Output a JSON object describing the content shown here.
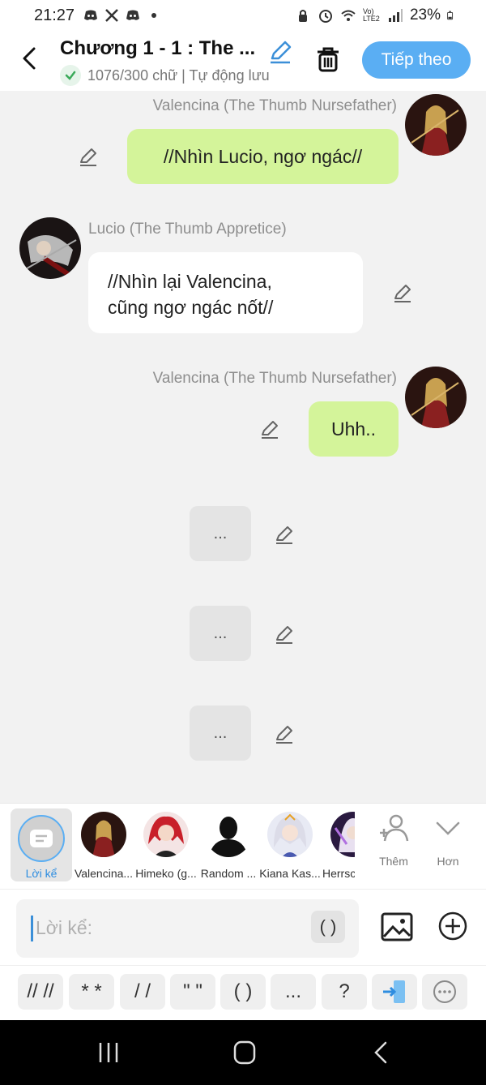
{
  "status": {
    "time": "21:27",
    "battery": "23%",
    "network_label": "Vo) LTE2",
    "left_icons": [
      "discord-icon",
      "x-icon",
      "discord-icon",
      "dot"
    ]
  },
  "header": {
    "title": "Chương 1 - 1 : The ...",
    "word_count": "1076/300 chữ | Tự động lưu",
    "next_label": "Tiếp theo"
  },
  "messages": [
    {
      "speaker": "Valencina (The Thumb Nursefather)",
      "text": "//Nhìn Lucio, ngơ ngác//",
      "side": "right",
      "style": "green"
    },
    {
      "speaker": "Lucio (The Thumb Appretice)",
      "text_line1": "//Nhìn lại Valencina,",
      "text_line2": "cũng ngơ ngác nốt//",
      "side": "left",
      "style": "white"
    },
    {
      "speaker": "Valencina (The Thumb Nursefather)",
      "text": "Uhh..",
      "side": "right",
      "style": "green"
    },
    {
      "text": "...",
      "style": "narration"
    },
    {
      "text": "...",
      "style": "narration"
    },
    {
      "text": "...",
      "style": "narration"
    }
  ],
  "characters": {
    "narrator_label": "Lời kể",
    "items": [
      {
        "label": "Valencina..."
      },
      {
        "label": "Himeko (g..."
      },
      {
        "label": "Random ..."
      },
      {
        "label": "Kiana Kas..."
      },
      {
        "label": "Herrsc"
      }
    ],
    "add_label": "Thêm",
    "more_label": "Hơn"
  },
  "input": {
    "placeholder": "Lời kể:",
    "paren_label": "( )"
  },
  "quick_buttons": [
    "// //",
    "* *",
    "/ /",
    "\" \"",
    "( )",
    "...",
    "?"
  ],
  "colors": {
    "accent": "#5aaef3",
    "green_bubble": "#d4f49a",
    "background": "#f2f2f2"
  }
}
